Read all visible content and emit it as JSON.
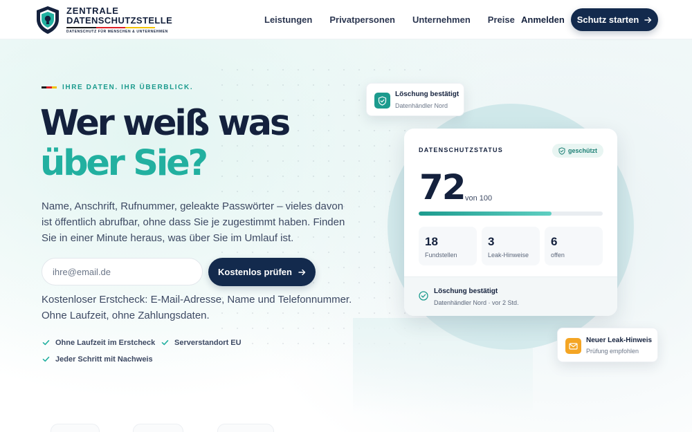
{
  "brand": {
    "line1": "ZENTRALE",
    "line2": "DATENSCHUTZSTELLE",
    "tagline": "DATENSCHUTZ FÜR MENSCHEN & UNTERNEHMEN",
    "colors": {
      "navy": "#14213d",
      "teal": "#22b0a0",
      "flag_black": "#1a1a1a",
      "flag_red": "#dd1f26",
      "flag_gold": "#f2c200"
    }
  },
  "nav": {
    "items": [
      "Leistungen",
      "Privatpersonen",
      "Unternehmen",
      "Preise"
    ],
    "login": "Anmelden",
    "cta": "Schutz starten",
    "cta_icon": "arrow-right-icon"
  },
  "hero": {
    "eyebrow": "IHRE DATEN. IHR ÜBERBLICK.",
    "headline_line1": "Wer weiß was",
    "headline_line2": "über Sie?",
    "lead": "Name, Anschrift, Rufnummer, geleakte Passwörter – vieles davon ist öffentlich abrufbar, ohne dass Sie je zugestimmt haben. Finden Sie in einer Minute heraus, was über Sie im Umlauf ist.",
    "email_placeholder": "ihre@email.de",
    "submit": "Kostenlos prüfen",
    "subtext": "Kostenloser Erstcheck: E-Mail-Adresse, Name und Telefonnummer. Ohne Laufzeit, ohne Zahlungsdaten.",
    "features": [
      "Ohne Laufzeit im Erstcheck",
      "Serverstandort EU",
      "Jeder Schritt mit Nachweis"
    ]
  },
  "float_top": {
    "title": "Löschung bestätigt",
    "subtitle": "Datenhändler Nord",
    "icon": "shield-check-icon"
  },
  "status_card": {
    "heading": "DATENSCHUTZSTATUS",
    "badge": "geschützt",
    "score": "72",
    "score_of": "von 100",
    "progress": 0.72,
    "stats": [
      {
        "value": "18",
        "label": "Fundstellen"
      },
      {
        "value": "3",
        "label": "Leak-Hinweise"
      },
      {
        "value": "6",
        "label": "offen"
      }
    ],
    "footer_title": "Löschung bestätigt",
    "footer_sub": "Datenhändler Nord · vor 2 Std."
  },
  "float_bottom": {
    "title": "Neuer Leak-Hinweis",
    "subtitle": "Prüfung empfohlen",
    "icon": "mail-icon"
  }
}
